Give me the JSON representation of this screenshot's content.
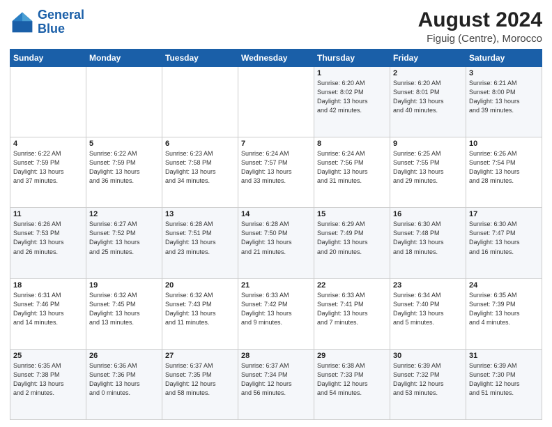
{
  "logo": {
    "line1": "General",
    "line2": "Blue"
  },
  "header": {
    "month": "August 2024",
    "location": "Figuig (Centre), Morocco"
  },
  "weekdays": [
    "Sunday",
    "Monday",
    "Tuesday",
    "Wednesday",
    "Thursday",
    "Friday",
    "Saturday"
  ],
  "weeks": [
    [
      {
        "day": "",
        "info": ""
      },
      {
        "day": "",
        "info": ""
      },
      {
        "day": "",
        "info": ""
      },
      {
        "day": "",
        "info": ""
      },
      {
        "day": "1",
        "info": "Sunrise: 6:20 AM\nSunset: 8:02 PM\nDaylight: 13 hours\nand 42 minutes."
      },
      {
        "day": "2",
        "info": "Sunrise: 6:20 AM\nSunset: 8:01 PM\nDaylight: 13 hours\nand 40 minutes."
      },
      {
        "day": "3",
        "info": "Sunrise: 6:21 AM\nSunset: 8:00 PM\nDaylight: 13 hours\nand 39 minutes."
      }
    ],
    [
      {
        "day": "4",
        "info": "Sunrise: 6:22 AM\nSunset: 7:59 PM\nDaylight: 13 hours\nand 37 minutes."
      },
      {
        "day": "5",
        "info": "Sunrise: 6:22 AM\nSunset: 7:59 PM\nDaylight: 13 hours\nand 36 minutes."
      },
      {
        "day": "6",
        "info": "Sunrise: 6:23 AM\nSunset: 7:58 PM\nDaylight: 13 hours\nand 34 minutes."
      },
      {
        "day": "7",
        "info": "Sunrise: 6:24 AM\nSunset: 7:57 PM\nDaylight: 13 hours\nand 33 minutes."
      },
      {
        "day": "8",
        "info": "Sunrise: 6:24 AM\nSunset: 7:56 PM\nDaylight: 13 hours\nand 31 minutes."
      },
      {
        "day": "9",
        "info": "Sunrise: 6:25 AM\nSunset: 7:55 PM\nDaylight: 13 hours\nand 29 minutes."
      },
      {
        "day": "10",
        "info": "Sunrise: 6:26 AM\nSunset: 7:54 PM\nDaylight: 13 hours\nand 28 minutes."
      }
    ],
    [
      {
        "day": "11",
        "info": "Sunrise: 6:26 AM\nSunset: 7:53 PM\nDaylight: 13 hours\nand 26 minutes."
      },
      {
        "day": "12",
        "info": "Sunrise: 6:27 AM\nSunset: 7:52 PM\nDaylight: 13 hours\nand 25 minutes."
      },
      {
        "day": "13",
        "info": "Sunrise: 6:28 AM\nSunset: 7:51 PM\nDaylight: 13 hours\nand 23 minutes."
      },
      {
        "day": "14",
        "info": "Sunrise: 6:28 AM\nSunset: 7:50 PM\nDaylight: 13 hours\nand 21 minutes."
      },
      {
        "day": "15",
        "info": "Sunrise: 6:29 AM\nSunset: 7:49 PM\nDaylight: 13 hours\nand 20 minutes."
      },
      {
        "day": "16",
        "info": "Sunrise: 6:30 AM\nSunset: 7:48 PM\nDaylight: 13 hours\nand 18 minutes."
      },
      {
        "day": "17",
        "info": "Sunrise: 6:30 AM\nSunset: 7:47 PM\nDaylight: 13 hours\nand 16 minutes."
      }
    ],
    [
      {
        "day": "18",
        "info": "Sunrise: 6:31 AM\nSunset: 7:46 PM\nDaylight: 13 hours\nand 14 minutes."
      },
      {
        "day": "19",
        "info": "Sunrise: 6:32 AM\nSunset: 7:45 PM\nDaylight: 13 hours\nand 13 minutes."
      },
      {
        "day": "20",
        "info": "Sunrise: 6:32 AM\nSunset: 7:43 PM\nDaylight: 13 hours\nand 11 minutes."
      },
      {
        "day": "21",
        "info": "Sunrise: 6:33 AM\nSunset: 7:42 PM\nDaylight: 13 hours\nand 9 minutes."
      },
      {
        "day": "22",
        "info": "Sunrise: 6:33 AM\nSunset: 7:41 PM\nDaylight: 13 hours\nand 7 minutes."
      },
      {
        "day": "23",
        "info": "Sunrise: 6:34 AM\nSunset: 7:40 PM\nDaylight: 13 hours\nand 5 minutes."
      },
      {
        "day": "24",
        "info": "Sunrise: 6:35 AM\nSunset: 7:39 PM\nDaylight: 13 hours\nand 4 minutes."
      }
    ],
    [
      {
        "day": "25",
        "info": "Sunrise: 6:35 AM\nSunset: 7:38 PM\nDaylight: 13 hours\nand 2 minutes."
      },
      {
        "day": "26",
        "info": "Sunrise: 6:36 AM\nSunset: 7:36 PM\nDaylight: 13 hours\nand 0 minutes."
      },
      {
        "day": "27",
        "info": "Sunrise: 6:37 AM\nSunset: 7:35 PM\nDaylight: 12 hours\nand 58 minutes."
      },
      {
        "day": "28",
        "info": "Sunrise: 6:37 AM\nSunset: 7:34 PM\nDaylight: 12 hours\nand 56 minutes."
      },
      {
        "day": "29",
        "info": "Sunrise: 6:38 AM\nSunset: 7:33 PM\nDaylight: 12 hours\nand 54 minutes."
      },
      {
        "day": "30",
        "info": "Sunrise: 6:39 AM\nSunset: 7:32 PM\nDaylight: 12 hours\nand 53 minutes."
      },
      {
        "day": "31",
        "info": "Sunrise: 6:39 AM\nSunset: 7:30 PM\nDaylight: 12 hours\nand 51 minutes."
      }
    ]
  ]
}
